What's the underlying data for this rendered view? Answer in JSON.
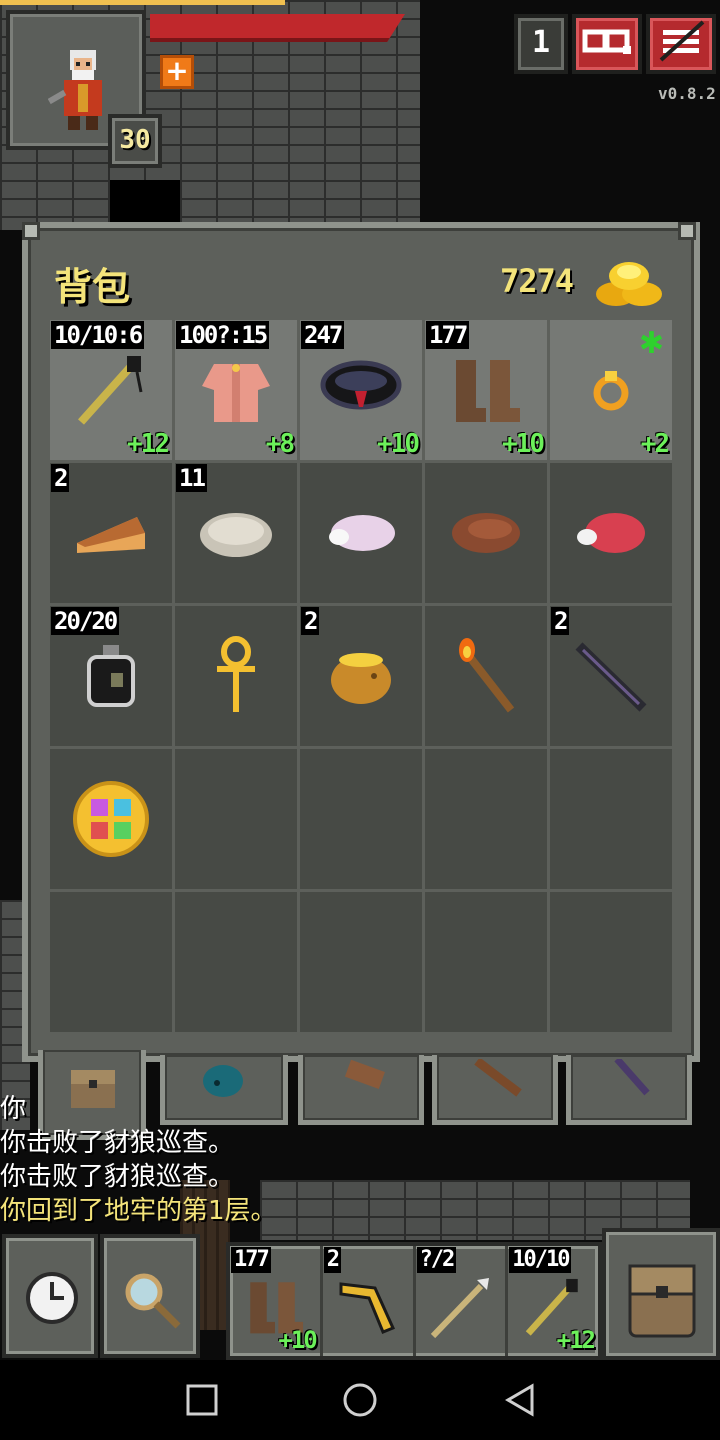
{
  "hud": {
    "hero_level": "30",
    "depth": "1",
    "version": "v0.8.2",
    "buff_symbol": "+",
    "journal_icon": "journal-icon",
    "menu_icon": "menu-icon"
  },
  "backpack": {
    "title": "背包",
    "gold": "7274",
    "equipped": [
      {
        "name": "wand",
        "top": "10/10:6",
        "bottom": "+12"
      },
      {
        "name": "armor",
        "top": "100?:15",
        "bottom": "+8"
      },
      {
        "name": "belt",
        "top": "247",
        "bottom": "+10"
      },
      {
        "name": "boots",
        "top": "177",
        "bottom": "+10"
      },
      {
        "name": "ring",
        "top": "",
        "bottom": "+2"
      }
    ],
    "items": [
      {
        "name": "pie",
        "top": "2"
      },
      {
        "name": "bread",
        "top": "11"
      },
      {
        "name": "mystery-meat",
        "top": ""
      },
      {
        "name": "cooked-meat",
        "top": ""
      },
      {
        "name": "raw-meat",
        "top": ""
      },
      {
        "name": "waterskin",
        "top": "20/20"
      },
      {
        "name": "ankh",
        "top": ""
      },
      {
        "name": "honeypot",
        "top": "2"
      },
      {
        "name": "torch",
        "top": ""
      },
      {
        "name": "dart",
        "top": "2"
      },
      {
        "name": "compass-tome",
        "top": ""
      }
    ]
  },
  "log": [
    "你",
    "你击败了豺狼巡查。",
    "你击败了豺狼巡查。",
    "你回到了地牢的第1层。"
  ],
  "quickslots": [
    {
      "name": "boots",
      "top": "177",
      "bottom": "+10"
    },
    {
      "name": "boomerang",
      "top": "2",
      "bottom": ""
    },
    {
      "name": "spear",
      "top": "?/2",
      "bottom": ""
    },
    {
      "name": "wand",
      "top": "10/10",
      "bottom": "+12"
    }
  ],
  "colors": {
    "accent": "#f4e47a",
    "bonus": "#6cf05a",
    "hp": "#c0282c"
  }
}
